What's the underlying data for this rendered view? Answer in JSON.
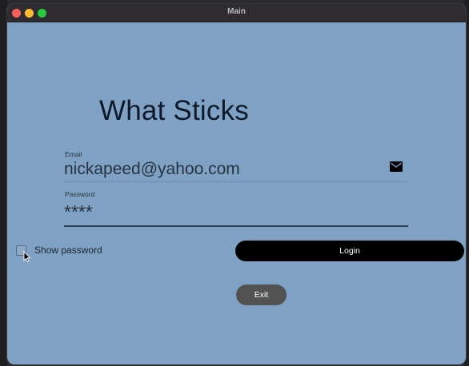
{
  "window": {
    "title": "Main"
  },
  "app": {
    "heading": "What Sticks"
  },
  "email": {
    "label": "Email",
    "value": "nickapeed@yahoo.com",
    "icon": "mail-icon"
  },
  "password": {
    "label": "Password",
    "value": "****"
  },
  "show_password": {
    "label": "Show password",
    "checked": false
  },
  "buttons": {
    "login": "Login",
    "exit": "Exit"
  },
  "colors": {
    "window_background": "#7fa2c4",
    "login_button": "#000000",
    "exit_button": "#525252"
  }
}
